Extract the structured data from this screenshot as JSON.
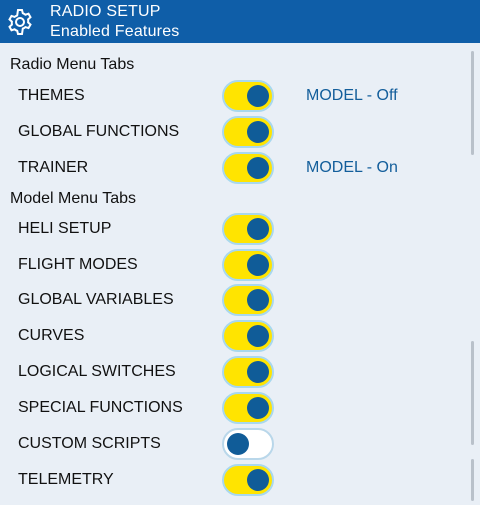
{
  "header": {
    "title": "RADIO SETUP",
    "subtitle": "Enabled Features",
    "icon": "gear-icon"
  },
  "colors": {
    "header_bg": "#0f5ea8",
    "page_bg": "#e9eff6",
    "toggle_on_bg": "#ffe400",
    "toggle_knob": "#105c98",
    "status_text": "#135e9b"
  },
  "sections": {
    "radio_label": "Radio Menu Tabs",
    "model_label": "Model Menu Tabs"
  },
  "radio_items": [
    {
      "label": "THEMES",
      "enabled": true,
      "status": "MODEL - Off"
    },
    {
      "label": "GLOBAL FUNCTIONS",
      "enabled": true,
      "status": ""
    },
    {
      "label": "TRAINER",
      "enabled": true,
      "status": "MODEL - On"
    }
  ],
  "model_items": [
    {
      "label": "HELI SETUP",
      "enabled": true
    },
    {
      "label": "FLIGHT MODES",
      "enabled": true
    },
    {
      "label": "GLOBAL VARIABLES",
      "enabled": true
    },
    {
      "label": "CURVES",
      "enabled": true
    },
    {
      "label": "LOGICAL SWITCHES",
      "enabled": true
    },
    {
      "label": "SPECIAL FUNCTIONS",
      "enabled": true
    },
    {
      "label": "CUSTOM SCRIPTS",
      "enabled": false
    },
    {
      "label": "TELEMETRY",
      "enabled": true
    }
  ]
}
